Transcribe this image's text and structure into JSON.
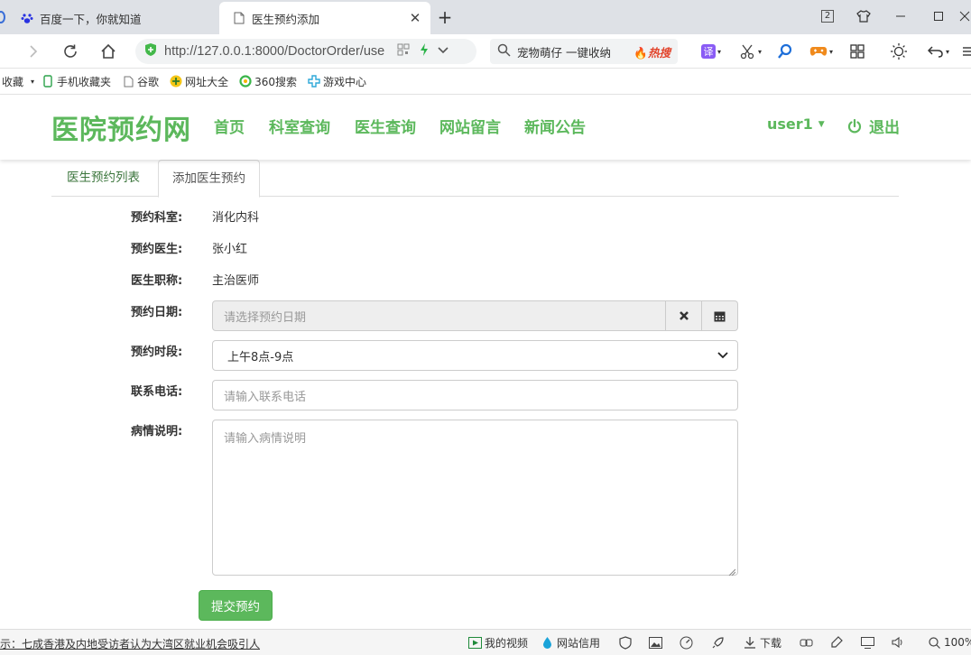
{
  "browser": {
    "tabs": [
      {
        "title": "百度一下，你就知道",
        "icon": "baidu-paw-icon",
        "active": false
      },
      {
        "title": "医生预约添加",
        "icon": "page-icon",
        "active": true
      }
    ],
    "address": {
      "url": "http://127.0.0.1:8000/DoctorOrder/use"
    },
    "search": {
      "text": "宠物萌仔 一键收纳",
      "hot_label": "热搜"
    },
    "bookmarks": [
      {
        "label": "收藏",
        "icon": "star-icon"
      },
      {
        "label": "手机收藏夹",
        "icon": "phone-icon"
      },
      {
        "label": "谷歌",
        "icon": "page-icon"
      },
      {
        "label": "网址大全",
        "icon": "globe-icon"
      },
      {
        "label": "360搜索",
        "icon": "search-360-icon"
      },
      {
        "label": "游戏中心",
        "icon": "game-icon"
      }
    ],
    "window_badge": "2",
    "statusbar": {
      "news": "示：七成香港及内地受访者认为大湾区就业机会吸引人",
      "my_video": "我的视频",
      "site_credit": "网站信用",
      "download": "下载",
      "zoom": "100%"
    }
  },
  "site": {
    "logo": "医院预约网",
    "nav": [
      "首页",
      "科室查询",
      "医生查询",
      "网站留言",
      "新闻公告"
    ],
    "user": "user1",
    "logout": "退出",
    "brand_color": "#5cb85c"
  },
  "page": {
    "tabs": [
      "医生预约列表",
      "添加医生预约"
    ],
    "form": {
      "department_label": "预约科室:",
      "department_value": "消化内科",
      "doctor_label": "预约医生:",
      "doctor_value": "张小红",
      "title_label": "医生职称:",
      "title_value": "主治医师",
      "date_label": "预约日期:",
      "date_placeholder": "请选择预约日期",
      "time_label": "预约时段:",
      "time_value": "上午8点-9点",
      "phone_label": "联系电话:",
      "phone_placeholder": "请输入联系电话",
      "desc_label": "病情说明:",
      "desc_placeholder": "请输入病情说明",
      "submit_label": "提交预约"
    }
  }
}
